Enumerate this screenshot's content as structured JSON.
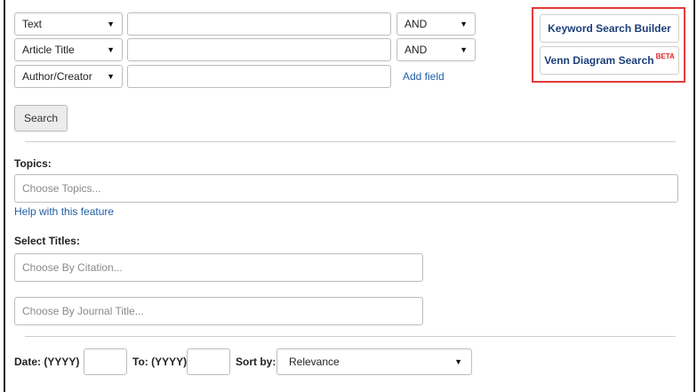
{
  "query_rows": [
    {
      "field": "Text",
      "operator": "AND"
    },
    {
      "field": "Article Title",
      "operator": "AND"
    },
    {
      "field": "Author/Creator"
    }
  ],
  "add_field_label": "Add field",
  "search_button_label": "Search",
  "builder": {
    "keyword_label": "Keyword Search Builder",
    "venn_label": "Venn Diagram Search",
    "venn_badge": "BETA",
    "highlight_color": "#e23b3b"
  },
  "topics": {
    "label": "Topics:",
    "placeholder": "Choose Topics...",
    "help_link": "Help with this feature"
  },
  "titles": {
    "label": "Select Titles:",
    "citation_placeholder": "Choose By Citation...",
    "journal_placeholder": "Choose By Journal Title..."
  },
  "filters": {
    "date_from_label": "Date: (YYYY)",
    "date_to_label": "To: (YYYY)",
    "sort_label": "Sort by:",
    "sort_value": "Relevance"
  },
  "colors": {
    "link": "#1f5fa8",
    "button_text": "#1d3f7a"
  }
}
